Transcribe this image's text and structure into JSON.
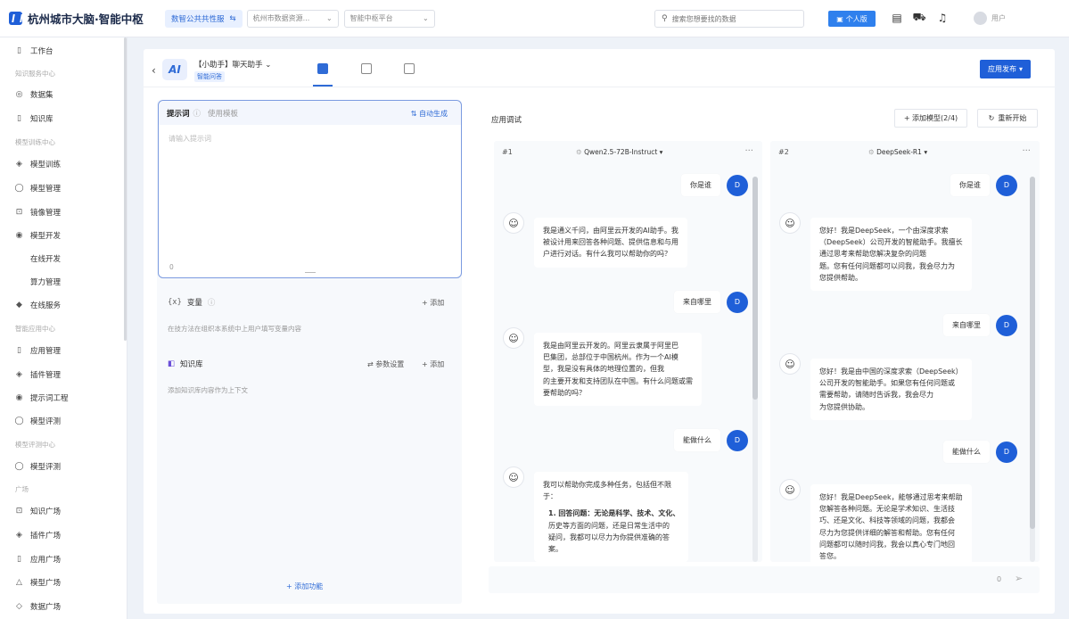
{
  "header": {
    "logo_text": "杭州城市大脑·智能中枢",
    "org_tag": "数智公共共性服",
    "org_tag_suffix": "⇆",
    "select1": "杭州市数据资源...",
    "select2": "智能中枢平台",
    "search_placeholder": "搜索您想要找的数据",
    "personal_btn": "个人版",
    "user_name": "用户"
  },
  "sidebar": {
    "items": [
      {
        "label": "工作台",
        "icon": "▯"
      },
      {
        "group": "知识服务中心"
      },
      {
        "label": "数据集",
        "icon": "◎"
      },
      {
        "label": "知识库",
        "icon": "▯"
      },
      {
        "group": "模型训练中心"
      },
      {
        "label": "模型训练",
        "icon": "◈"
      },
      {
        "label": "模型管理",
        "icon": "◯"
      },
      {
        "label": "镜像管理",
        "icon": "⊡"
      },
      {
        "label": "模型开发",
        "icon": "◉"
      },
      {
        "sub": "在线开发"
      },
      {
        "sub": "算力管理"
      },
      {
        "label": "在线服务",
        "icon": "◆"
      },
      {
        "group": "智能应用中心"
      },
      {
        "label": "应用管理",
        "icon": "▯"
      },
      {
        "label": "插件管理",
        "icon": "◈"
      },
      {
        "label": "提示词工程",
        "icon": "◉"
      },
      {
        "label": "模型评测",
        "icon": "◯"
      },
      {
        "group": "模型评测中心"
      },
      {
        "label": "模型评测",
        "icon": "◯"
      },
      {
        "group": "广场"
      },
      {
        "label": "知识广场",
        "icon": "⊡"
      },
      {
        "label": "插件广场",
        "icon": "◈"
      },
      {
        "label": "应用广场",
        "icon": "▯"
      },
      {
        "label": "模型广场",
        "icon": "△"
      },
      {
        "label": "数据广场",
        "icon": "◇"
      }
    ]
  },
  "app": {
    "name": "【小助手】聊天助手",
    "sub": "智能问答",
    "publish_btn": "应用发布"
  },
  "prompt": {
    "title": "提示词",
    "template": "使用模板",
    "auto_gen": "自动生成",
    "placeholder": "请输入提示词",
    "count": "0"
  },
  "variables": {
    "title": "变量",
    "desc": "在技方法在组织本系统中上用户填写变量内容",
    "add": "+ 添加"
  },
  "knowledge": {
    "title": "知识库",
    "params": "参数设置",
    "add": "+ 添加",
    "desc": "添加知识库内容作为上下文"
  },
  "add_function": "+ 添加功能",
  "debug": {
    "title": "应用调试",
    "add_model": "+ 添加模型(2/4)",
    "restart": "重新开始"
  },
  "chats": [
    {
      "num": "#1",
      "model": "Qwen2.5-72B-Instruct",
      "messages": [
        {
          "role": "user",
          "text": "你是谁"
        },
        {
          "role": "bot",
          "lines": [
            "我是通义千问，由阿里云开发的AI助手。我",
            "被设计用来回答各种问题、提供信息和与用",
            "户进行对话。有什么我可以帮助你的吗？"
          ]
        },
        {
          "role": "user",
          "text": "来自哪里"
        },
        {
          "role": "bot",
          "lines": [
            "我是由阿里云开发的。阿里云隶属于阿里巴",
            "巴集团，总部位于中国杭州。作为一个AI模",
            "型，我是没有具体的地理位置的，但我",
            "的主要开发和支持团队在中国。有什么问题或需",
            "要帮助的吗？"
          ]
        },
        {
          "role": "user",
          "text": "能做什么"
        },
        {
          "role": "bot",
          "lines": [
            "我可以帮助你完成多种任务，包括但不限",
            "于："
          ],
          "list": [
            "1. 回答问题：无论是科学、技术、文化、",
            "历史等方面的问题，还是日常生活中的",
            "疑问，我都可以尽力为你提供准确的答",
            "案。"
          ]
        }
      ]
    },
    {
      "num": "#2",
      "model": "DeepSeek-R1",
      "messages": [
        {
          "role": "user",
          "text": "你是谁"
        },
        {
          "role": "bot",
          "lines": [
            "您好！我是DeepSeek，一个由深度求索",
            "（DeepSeek）公司开发的智能助手。我擅长",
            "通过思考来帮助您解决复杂的问题",
            "题。您有任何问题都可以问我，我会尽力为",
            "您提供帮助。"
          ]
        },
        {
          "role": "user",
          "text": "来自哪里"
        },
        {
          "role": "bot",
          "lines": [
            "您好！我是由中国的深度求索（DeepSeek）",
            "公司开发的智能助手。如果您有任何问题或",
            "需要帮助，请随时告诉我，我会尽力",
            "为您提供协助。"
          ]
        },
        {
          "role": "user",
          "text": "能做什么"
        },
        {
          "role": "bot",
          "lines": [
            "您好！我是DeepSeek，能够通过思考来帮助",
            "您解答各种问题。无论是学术知识、生活技",
            "巧、还是文化、科技等领域的问题，我都会",
            "尽力为您提供详细的解答和帮助。您有任何",
            "问题都可以随时问我，我会以真心专门地回",
            "答您。"
          ]
        }
      ]
    }
  ],
  "bottom": {
    "count": "0",
    "send_icon": "send-icon"
  },
  "colors": {
    "primary": "#1f5fd8",
    "background": "#eef2f8"
  }
}
